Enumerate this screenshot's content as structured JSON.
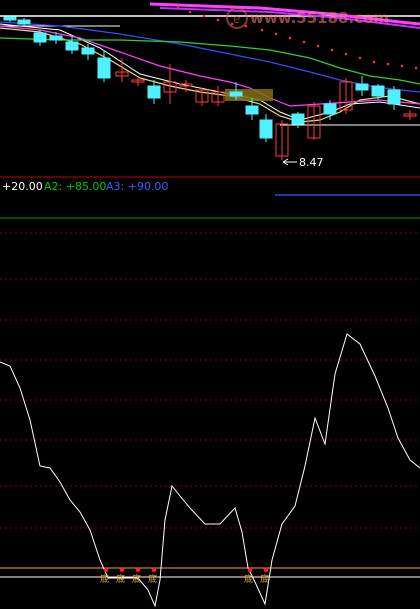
{
  "watermark": {
    "text": "www.55188.com"
  },
  "price_panel": {
    "low_label": "8.47"
  },
  "indicator_panel": {
    "levels": [
      {
        "label": "+20.00",
        "color": "#ffffff"
      },
      {
        "label": "A2: +85.00",
        "color": "#00c800"
      },
      {
        "label": "A3: +90.00",
        "color": "#3a5cff"
      }
    ],
    "bottom_markers": [
      "底",
      "底",
      "底",
      "底",
      "底",
      "底"
    ]
  },
  "colors": {
    "background": "#000000",
    "up": "#ff3b3b",
    "down": "#4ff0ff",
    "ma_white": "#ffffff",
    "ma_yellow": "#e8e070",
    "ma_magenta": "#ff40ff",
    "ma_green": "#30d030",
    "ma_blue": "#3050ff",
    "grid_red": "#8b0000",
    "marker_orange": "#ffa040"
  }
}
